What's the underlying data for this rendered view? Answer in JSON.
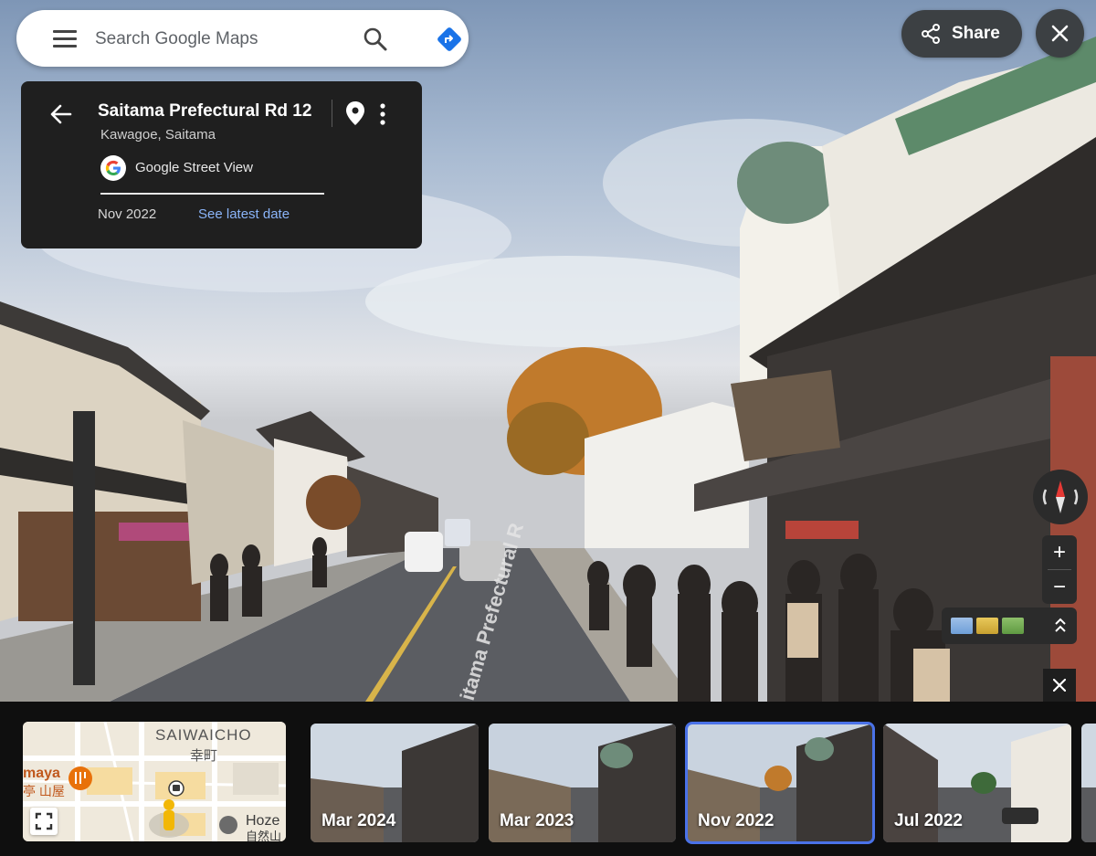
{
  "search": {
    "placeholder": "Search Google Maps",
    "menu_icon": "hamburger-menu-icon",
    "search_icon": "search-icon",
    "directions_icon": "directions-icon"
  },
  "info": {
    "title": "Saitama Prefectural Rd 12",
    "subtitle": "Kawagoe, Saitama",
    "source": "Google Street View",
    "date": "Nov 2022",
    "latest_link": "See latest date"
  },
  "toolbar": {
    "share_label": "Share"
  },
  "street_sign": "Saitama Prefectural Rd 12",
  "street_sign_visible": "itama Prefectural R",
  "minimap": {
    "district": "SAIWAICHO",
    "district_jp": "幸町",
    "poi_left_1": "maya",
    "poi_left_2": "亭 山屋",
    "poi_right_1": "Hoze",
    "poi_right_2": "自然山"
  },
  "timeline": [
    {
      "label": "Mar 2024",
      "selected": false
    },
    {
      "label": "Mar 2023",
      "selected": false
    },
    {
      "label": "Nov 2022",
      "selected": true
    },
    {
      "label": "Jul 2022",
      "selected": false
    }
  ],
  "colors": {
    "panel_bg": "#1f1f1f",
    "link": "#8ab4f8",
    "selected_outline": "#4a72e8",
    "directions": "#1a73e8"
  }
}
